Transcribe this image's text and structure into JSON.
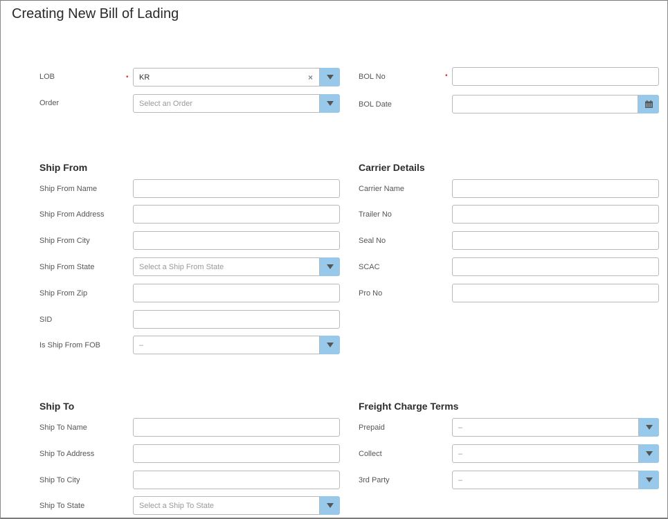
{
  "page": {
    "title": "Creating New Bill of Lading"
  },
  "colors": {
    "accent": "#99c9ea",
    "required": "#e0343a",
    "border": "#b8b8b8"
  },
  "header_fields": {
    "lob": {
      "label": "LOB",
      "value": "KR",
      "required": true,
      "clear_icon": "clear-icon"
    },
    "order": {
      "label": "Order",
      "placeholder": "Select an Order"
    },
    "bol_no": {
      "label": "BOL No",
      "value": "",
      "required": true
    },
    "bol_date": {
      "label": "BOL Date",
      "value": "",
      "icon": "calendar-icon"
    }
  },
  "ship_from": {
    "title": "Ship From",
    "name": {
      "label": "Ship From Name",
      "value": ""
    },
    "address": {
      "label": "Ship From Address",
      "value": ""
    },
    "city": {
      "label": "Ship From City",
      "value": ""
    },
    "state": {
      "label": "Ship From State",
      "placeholder": "Select a Ship From State"
    },
    "zip": {
      "label": "Ship From Zip",
      "value": ""
    },
    "sid": {
      "label": "SID",
      "value": ""
    },
    "fob": {
      "label": "Is Ship From FOB",
      "value": "–"
    }
  },
  "carrier": {
    "title": "Carrier Details",
    "name": {
      "label": "Carrier Name",
      "value": ""
    },
    "trailer": {
      "label": "Trailer No",
      "value": ""
    },
    "seal": {
      "label": "Seal No",
      "value": ""
    },
    "scac": {
      "label": "SCAC",
      "value": ""
    },
    "pro": {
      "label": "Pro No",
      "value": ""
    }
  },
  "ship_to": {
    "title": "Ship To",
    "name": {
      "label": "Ship To Name",
      "value": ""
    },
    "address": {
      "label": "Ship To Address",
      "value": ""
    },
    "city": {
      "label": "Ship To City",
      "value": ""
    },
    "state": {
      "label": "Ship To State",
      "placeholder": "Select a Ship To State"
    }
  },
  "freight": {
    "title": "Freight Charge Terms",
    "prepaid": {
      "label": "Prepaid",
      "value": "–"
    },
    "collect": {
      "label": "Collect",
      "value": "–"
    },
    "third_party": {
      "label": "3rd Party",
      "value": "–"
    }
  }
}
